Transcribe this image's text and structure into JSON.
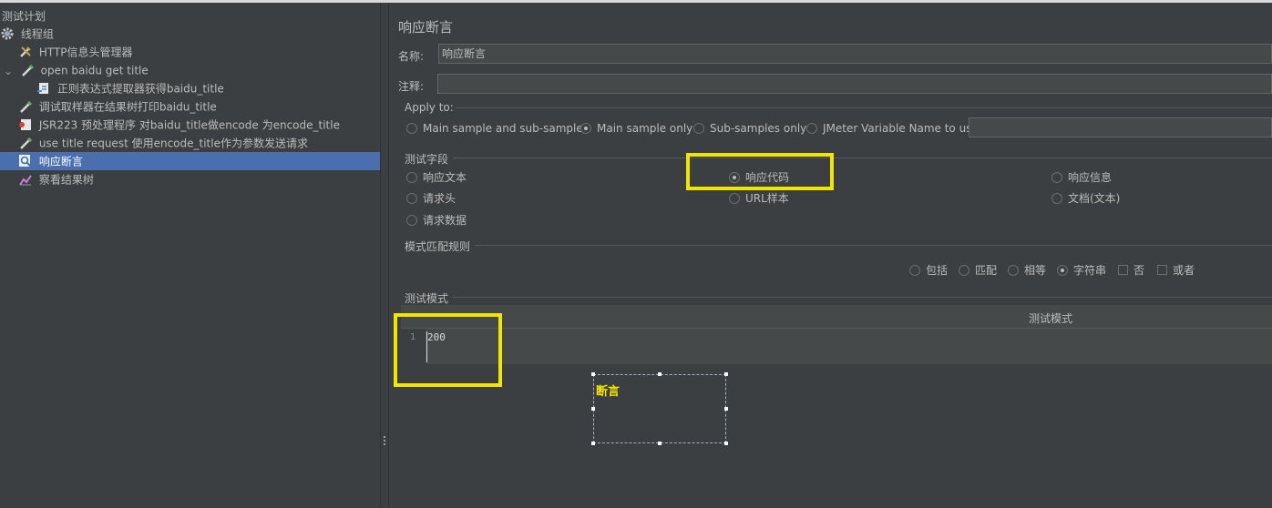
{
  "tree": {
    "items": [
      {
        "label": "测试计划",
        "icon": "none"
      },
      {
        "label": "线程组",
        "icon": "gear-icon"
      },
      {
        "label": "HTTP信息头管理器",
        "icon": "wrench-icon"
      },
      {
        "label": "open baidu get title",
        "icon": "pipette-icon"
      },
      {
        "label": "正则表达式提取器获得baidu_title",
        "icon": "document-arrow-icon"
      },
      {
        "label": "调试取样器在结果树打印baidu_title",
        "icon": "pipette-icon"
      },
      {
        "label": "JSR223 预处理程序  对baidu_title做encode 为encode_title",
        "icon": "script-icon"
      },
      {
        "label": "use title request  使用encode_title作为参数发送请求",
        "icon": "pipette-icon"
      },
      {
        "label": "响应断言",
        "icon": "magnifier-icon"
      },
      {
        "label": "察看结果树",
        "icon": "chart-icon"
      }
    ],
    "selected_index": 8
  },
  "panel": {
    "title": "响应断言",
    "name_label": "名称:",
    "name_value": "响应断言",
    "comment_label": "注释:",
    "comment_value": "",
    "apply_to": {
      "label": "Apply to:",
      "options": [
        "Main sample and sub-samples",
        "Main sample only",
        "Sub-samples only",
        "JMeter Variable Name to use"
      ],
      "selected": "Main sample only",
      "variable_value": ""
    },
    "test_field": {
      "label": "测试字段",
      "options": [
        "响应文本",
        "响应代码",
        "响应信息",
        "请求头",
        "URL样本",
        "文档(文本)",
        "请求数据"
      ],
      "selected": "响应代码"
    },
    "match_rules": {
      "label": "模式匹配规则",
      "radios": [
        "包括",
        "匹配",
        "相等",
        "字符串"
      ],
      "selected": "字符串",
      "checkboxes": [
        "否",
        "或者"
      ]
    },
    "test_patterns": {
      "label": "测试模式",
      "column_header": "测试模式",
      "rows": [
        {
          "line": "1",
          "value": "200"
        }
      ]
    },
    "annotation": {
      "text": "断言"
    }
  },
  "colors": {
    "background": "#3c3f41",
    "selection": "#4b6eaf",
    "highlight": "#f2e600"
  }
}
